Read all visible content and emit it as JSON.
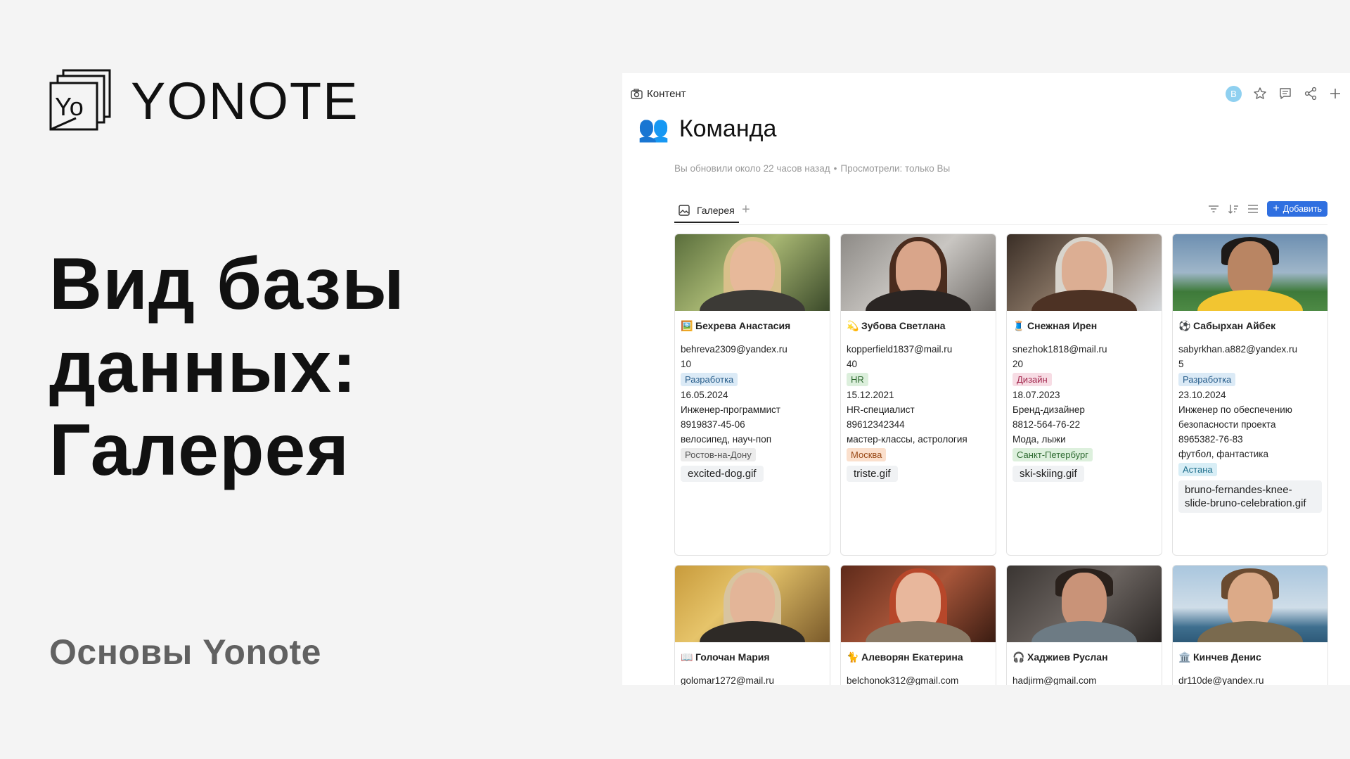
{
  "slide": {
    "logo_word": "YONOTE",
    "headline": [
      "Вид базы",
      "данных:",
      "Галерея"
    ],
    "subtitle": "Основы Yonote"
  },
  "app": {
    "breadcrumb": "Контент",
    "avatar_letter": "B",
    "page_emoji": "👥",
    "page_title": "Команда",
    "meta_updated": "Вы обновили около 22 часов назад",
    "meta_viewed": "Просмотрели: только Вы",
    "view_tab": "Галерея",
    "add_button": "Добавить"
  },
  "cards": [
    {
      "icon": "🖼️",
      "name": "Бехрева Анастасия",
      "email": "behreva2309@yandex.ru",
      "number": "10",
      "department": "Разработка",
      "date": "16.05.2024",
      "position": "Инженер-программист",
      "phone": "8919837-45-06",
      "hobbies": "велосипед, науч-поп",
      "city": "Ростов-на-Дону",
      "file": "excited-dog.gif"
    },
    {
      "icon": "💫",
      "name": "Зубова Светлана",
      "email": "kopperfield1837@mail.ru",
      "number": "40",
      "department": "HR",
      "date": "15.12.2021",
      "position": "HR-специалист",
      "phone": "89612342344",
      "hobbies": "мастер-классы, астрология",
      "city": "Москва",
      "file": "triste.gif"
    },
    {
      "icon": "🧵",
      "name": "Снежная Ирен",
      "email": "snezhok1818@mail.ru",
      "number": "20",
      "department": "Дизайн",
      "date": "18.07.2023",
      "position": "Бренд-дизайнер",
      "phone": "8812-564-76-22",
      "hobbies": "Мода, лыжи",
      "city": "Санкт-Петербург",
      "file": "ski-skiing.gif"
    },
    {
      "icon": "⚽",
      "name": "Сабырхан Айбек",
      "email": "sabyrkhan.a882@yandex.ru",
      "number": "5",
      "department": "Разработка",
      "date": "23.10.2024",
      "position": "Инженер по обеспечению безопасности проекта",
      "phone": "8965382-76-83",
      "hobbies": "футбол, фантастика",
      "city": "Астана",
      "file": "bruno-fernandes-knee-slide-bruno-celebration.gif"
    },
    {
      "icon": "📖",
      "name": "Голочан Мария",
      "email": "golomar1272@mail.ru"
    },
    {
      "icon": "🐈",
      "name": "Алеворян Екатерина",
      "email": "belchonok312@gmail.com"
    },
    {
      "icon": "🎧",
      "name": "Хаджиев Руслан",
      "email": "hadjirm@gmail.com"
    },
    {
      "icon": "🏛️",
      "name": "Кинчев Денис",
      "email": "dr110de@yandex.ru"
    }
  ],
  "colors": {
    "accent": "#2f6fe0",
    "avatar": "#8fd0f0"
  }
}
